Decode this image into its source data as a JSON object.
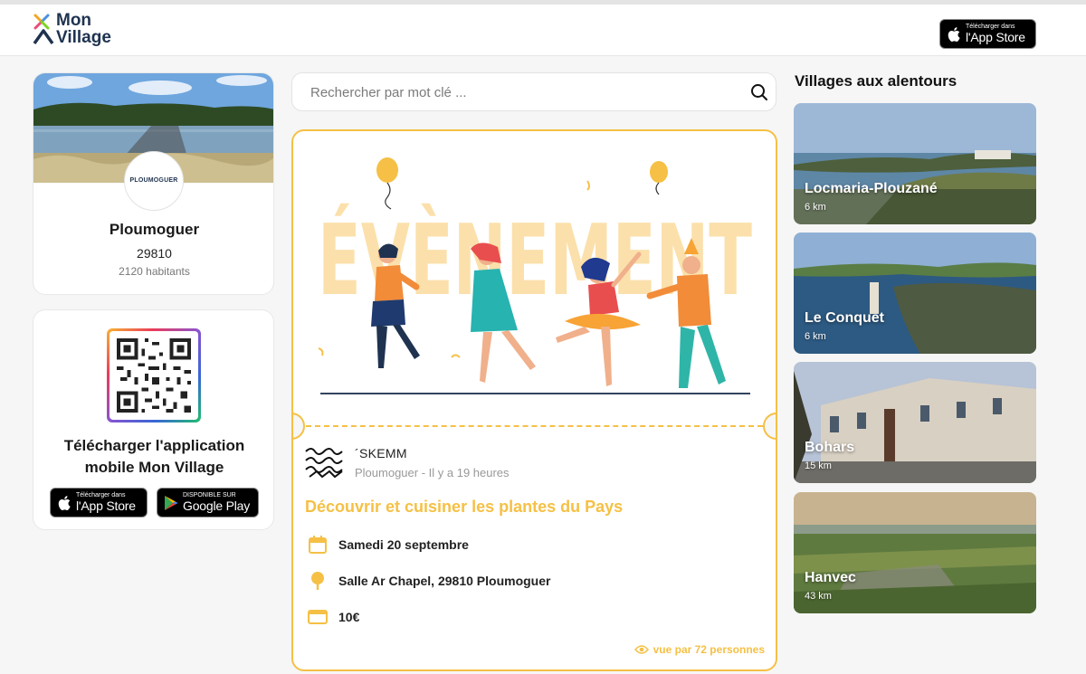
{
  "header": {
    "logo_line1": "Mon",
    "logo_line2": "Village",
    "appstore_small": "Télécharger dans",
    "appstore_big": "l'App Store"
  },
  "village": {
    "name": "Ploumoguer",
    "zip": "29810",
    "population": "2120 habitants",
    "badge": "PLOUMOGUER"
  },
  "app_promo": {
    "title_line1": "Télécharger l'application",
    "title_line2": "mobile Mon Village",
    "appstore_small": "Télécharger dans",
    "appstore_big": "l'App Store",
    "play_small": "DISPONIBLE SUR",
    "play_big": "Google Play"
  },
  "search": {
    "placeholder": "Rechercher par mot clé ..."
  },
  "event": {
    "banner_word": "ÉVÈNEMENT",
    "organizer": "´SKEMM",
    "meta": "Ploumoguer - Il y a 19 heures",
    "title": "Découvrir et cuisiner les plantes du Pays",
    "date": "Samedi 20 septembre",
    "place": "Salle Ar Chapel, 29810 Ploumoguer",
    "price": "10€",
    "views": "vue par 72 personnes"
  },
  "nearby": {
    "title": "Villages aux alentours",
    "items": [
      {
        "name": "Locmaria-Plouzané",
        "distance": "6 km"
      },
      {
        "name": "Le Conquet",
        "distance": "6 km"
      },
      {
        "name": "Bohars",
        "distance": "15 km"
      },
      {
        "name": "Hanvec",
        "distance": "43 km"
      }
    ]
  },
  "colors": {
    "accent": "#f5c045",
    "navy": "#1f3350"
  }
}
